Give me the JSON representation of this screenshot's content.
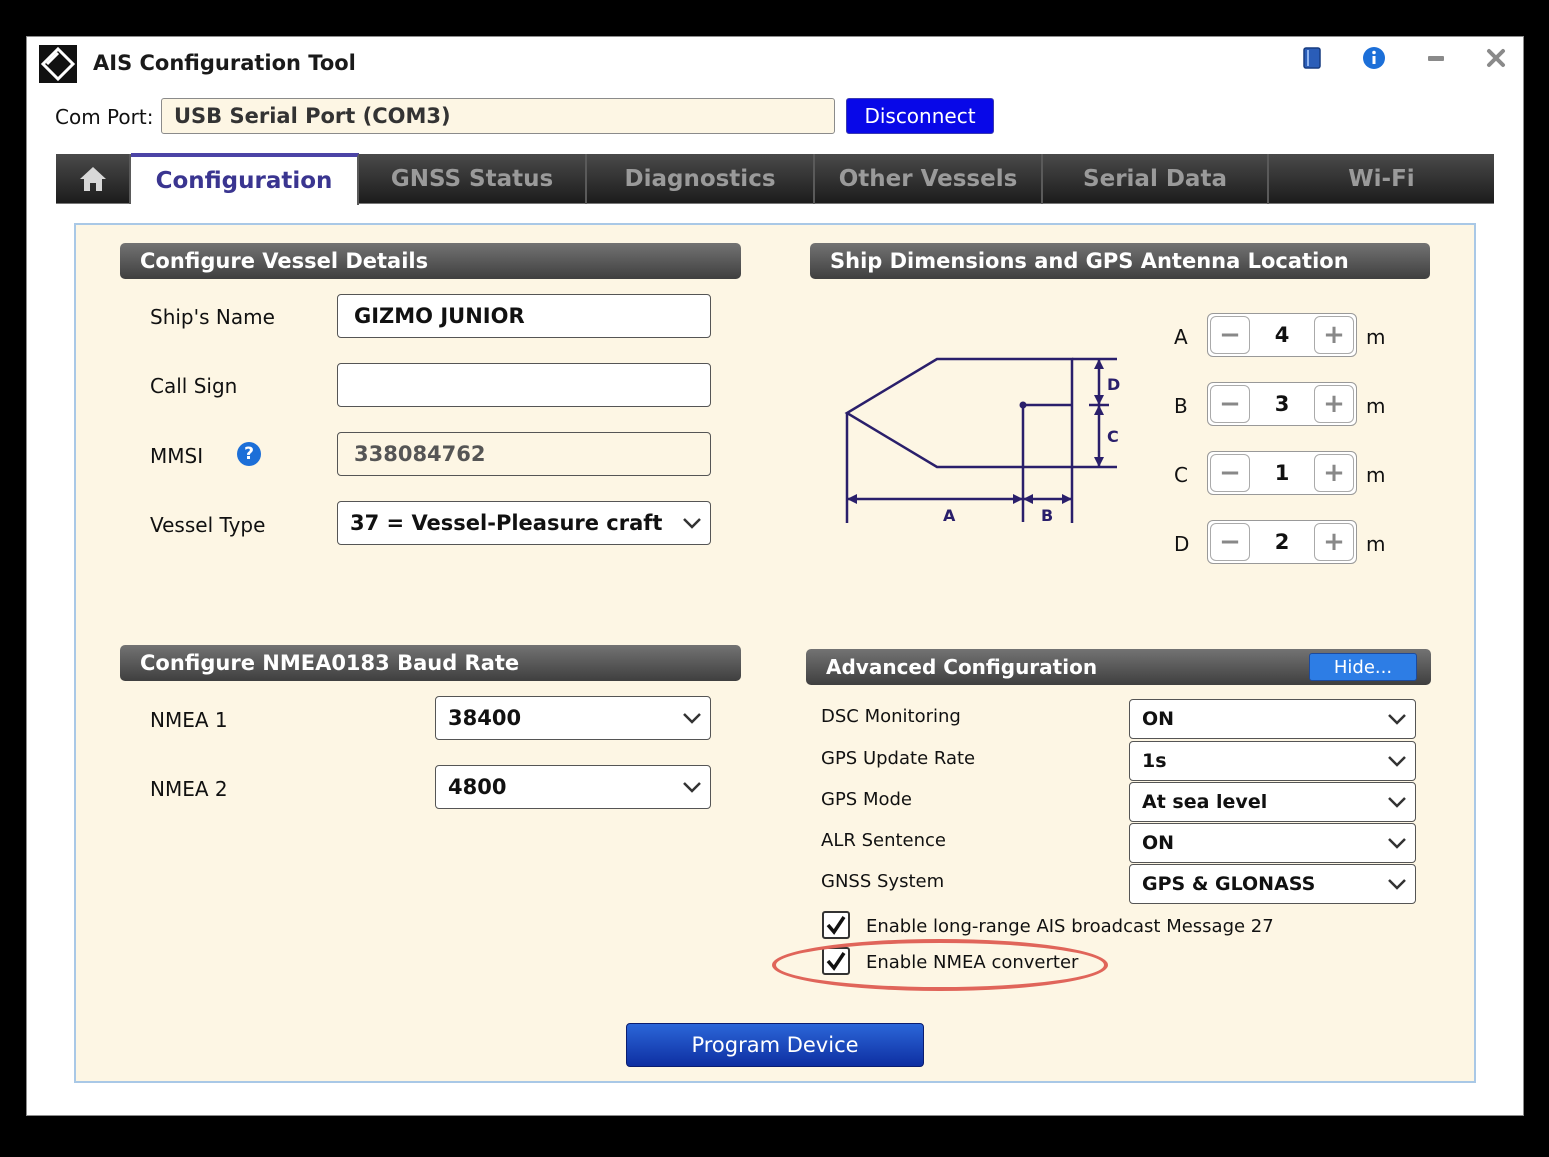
{
  "window": {
    "title": "AIS Configuration Tool"
  },
  "com_port": {
    "label": "Com Port:",
    "value": "USB Serial Port (COM3)",
    "disconnect_label": "Disconnect"
  },
  "tabs": [
    {
      "label": "Configuration"
    },
    {
      "label": "GNSS Status"
    },
    {
      "label": "Diagnostics"
    },
    {
      "label": "Other Vessels"
    },
    {
      "label": "Serial Data"
    },
    {
      "label": "Wi-Fi"
    }
  ],
  "vessel_details": {
    "header": "Configure Vessel Details",
    "ships_name_label": "Ship's Name",
    "ships_name_value": "GIZMO JUNIOR",
    "call_sign_label": "Call Sign",
    "call_sign_value": "",
    "mmsi_label": "MMSI",
    "mmsi_value": "338084762",
    "vessel_type_label": "Vessel Type",
    "vessel_type_value": "37 = Vessel-Pleasure craft"
  },
  "dimensions": {
    "header": "Ship Dimensions and GPS Antenna Location",
    "unit": "m",
    "diagram_labels": {
      "a": "A",
      "b": "B",
      "c": "C",
      "d": "D"
    },
    "rows": [
      {
        "label": "A",
        "value": "4"
      },
      {
        "label": "B",
        "value": "3"
      },
      {
        "label": "C",
        "value": "1"
      },
      {
        "label": "D",
        "value": "2"
      }
    ]
  },
  "baud": {
    "header": "Configure NMEA0183 Baud Rate",
    "nmea1_label": "NMEA 1",
    "nmea1_value": "38400",
    "nmea2_label": "NMEA 2",
    "nmea2_value": "4800"
  },
  "advanced": {
    "header": "Advanced Configuration",
    "hide_label": "Hide...",
    "rows": [
      {
        "label": "DSC Monitoring",
        "value": "ON"
      },
      {
        "label": "GPS Update Rate",
        "value": "1s"
      },
      {
        "label": "GPS Mode",
        "value": "At sea level"
      },
      {
        "label": "ALR Sentence",
        "value": "ON"
      },
      {
        "label": "GNSS System",
        "value": "GPS & GLONASS"
      }
    ],
    "msg27_label": "Enable long-range AIS broadcast Message 27",
    "msg27_checked": true,
    "nmea_converter_label": "Enable NMEA converter",
    "nmea_converter_checked": true
  },
  "program_label": "Program Device",
  "colors": {
    "accent_blue": "#0808e8",
    "tab_active_text": "#3a3590",
    "panel_background": "#fdf6e4",
    "highlight": "#e0655a"
  }
}
